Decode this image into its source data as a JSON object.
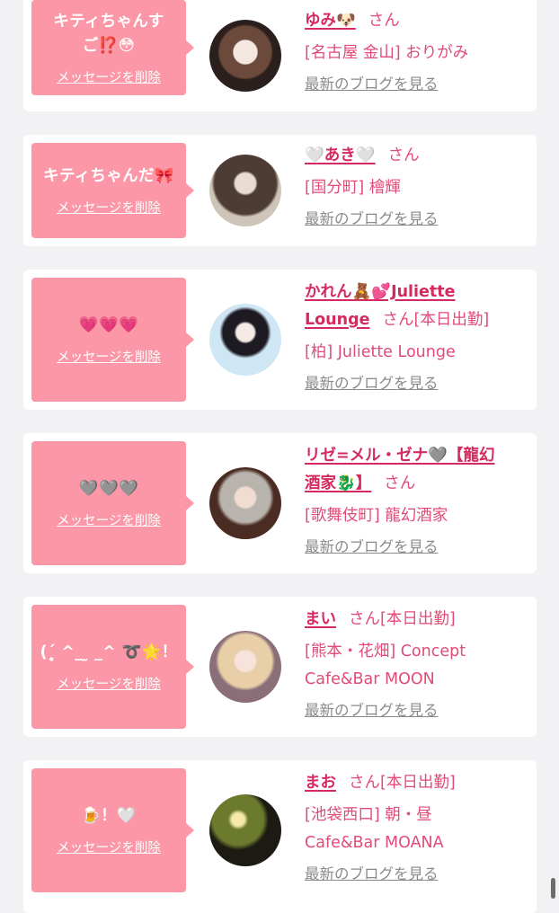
{
  "delete_label": "メッセージを削除",
  "blog_label": "最新のブログを見る",
  "san": "さん",
  "colors": {
    "bubble": "#fb97a7",
    "name": "#d42a5f",
    "text": "#e14b78",
    "blog_link": "#8a8a8a"
  },
  "cards": [
    {
      "message_lines": [
        "キティちゃんす",
        "ご⁉️😳"
      ],
      "name_lines": [
        "ゆみ🐶"
      ],
      "status": "",
      "location_lines": [
        "[名古屋 金山] おりがみ"
      ]
    },
    {
      "message_lines": [
        "キティちゃんだ🎀"
      ],
      "name_lines": [
        "🤍あき🤍"
      ],
      "status": "",
      "location_lines": [
        "[国分町] 檜輝"
      ]
    },
    {
      "message_lines": [
        "💗💗💗"
      ],
      "name_lines": [
        "かれん🧸💕Juliette",
        "Lounge"
      ],
      "status": "[本日出勤]",
      "location_lines": [
        "[柏] Juliette Lounge"
      ]
    },
    {
      "message_lines": [
        "🩶🩶🩶"
      ],
      "name_lines": [
        "リゼ=メル・ゼナ🩶【龍幻",
        "酒家🐉】"
      ],
      "status": "",
      "location_lines": [
        "[歌舞伎町] 龍幻酒家"
      ]
    },
    {
      "message_lines": [
        "(ˊ̥̥̥̥̥ ^_ ̫ _^ ➰🌟！"
      ],
      "name_lines": [
        "まい"
      ],
      "status": "[本日出勤]",
      "location_lines": [
        "[熊本・花畑] Concept",
        "Cafe&Bar MOON"
      ]
    },
    {
      "message_lines": [
        "🍺！🤍"
      ],
      "name_lines": [
        "まお"
      ],
      "status": "[本日出勤]",
      "location_lines": [
        "[池袋西口] 朝・昼",
        "Cafe&Bar MOANA"
      ]
    }
  ]
}
